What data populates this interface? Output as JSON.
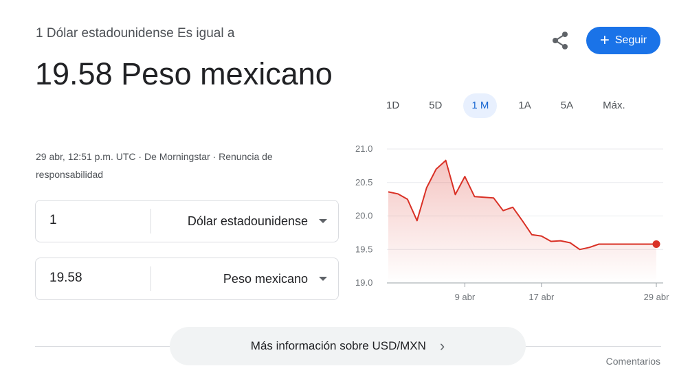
{
  "header": {
    "subtitle": "1 Dólar estadounidense Es igual a",
    "amount": "19.58 Peso mexicano",
    "meta": "29 abr, 12:51 p.m. UTC · De Morningstar · Renuncia de responsabilidad"
  },
  "actions": {
    "share_icon": "share-icon",
    "follow_label": "Seguir"
  },
  "converter": {
    "from": {
      "value": "1",
      "currency": "Dólar estadounidense"
    },
    "to": {
      "value": "19.58",
      "currency": "Peso mexicano"
    }
  },
  "ranges": [
    {
      "label": "1D",
      "active": false
    },
    {
      "label": "5D",
      "active": false
    },
    {
      "label": "1 M",
      "active": true
    },
    {
      "label": "1A",
      "active": false
    },
    {
      "label": "5A",
      "active": false
    },
    {
      "label": "Máx.",
      "active": false
    }
  ],
  "chart_data": {
    "type": "area",
    "ylim": [
      19.0,
      21.0
    ],
    "yticks": [
      "21.0",
      "20.5",
      "20.0",
      "19.5",
      "19.0"
    ],
    "xtick_labels": [
      {
        "label": "9 abr",
        "day": 9
      },
      {
        "label": "17 abr",
        "day": 17
      },
      {
        "label": "29 abr",
        "day": 29
      }
    ],
    "x": [
      1,
      2,
      3,
      4,
      5,
      6,
      7,
      8,
      9,
      10,
      11,
      12,
      13,
      14,
      15,
      16,
      17,
      18,
      19,
      20,
      21,
      22,
      23,
      24,
      25,
      26,
      27,
      28,
      29
    ],
    "series": [
      {
        "values": [
          20.36,
          20.33,
          20.25,
          19.93,
          20.42,
          20.7,
          20.83,
          20.32,
          20.59,
          20.29,
          20.28,
          20.27,
          20.08,
          20.13,
          19.93,
          19.72,
          19.7,
          19.62,
          19.63,
          19.6,
          19.5,
          19.53,
          19.58,
          19.58,
          19.58,
          19.58,
          19.58,
          19.58,
          19.58
        ],
        "color": "#d93025"
      }
    ],
    "grid": true
  },
  "footer": {
    "more_label": "Más información sobre USD/MXN",
    "feedback_label": "Comentarios"
  }
}
